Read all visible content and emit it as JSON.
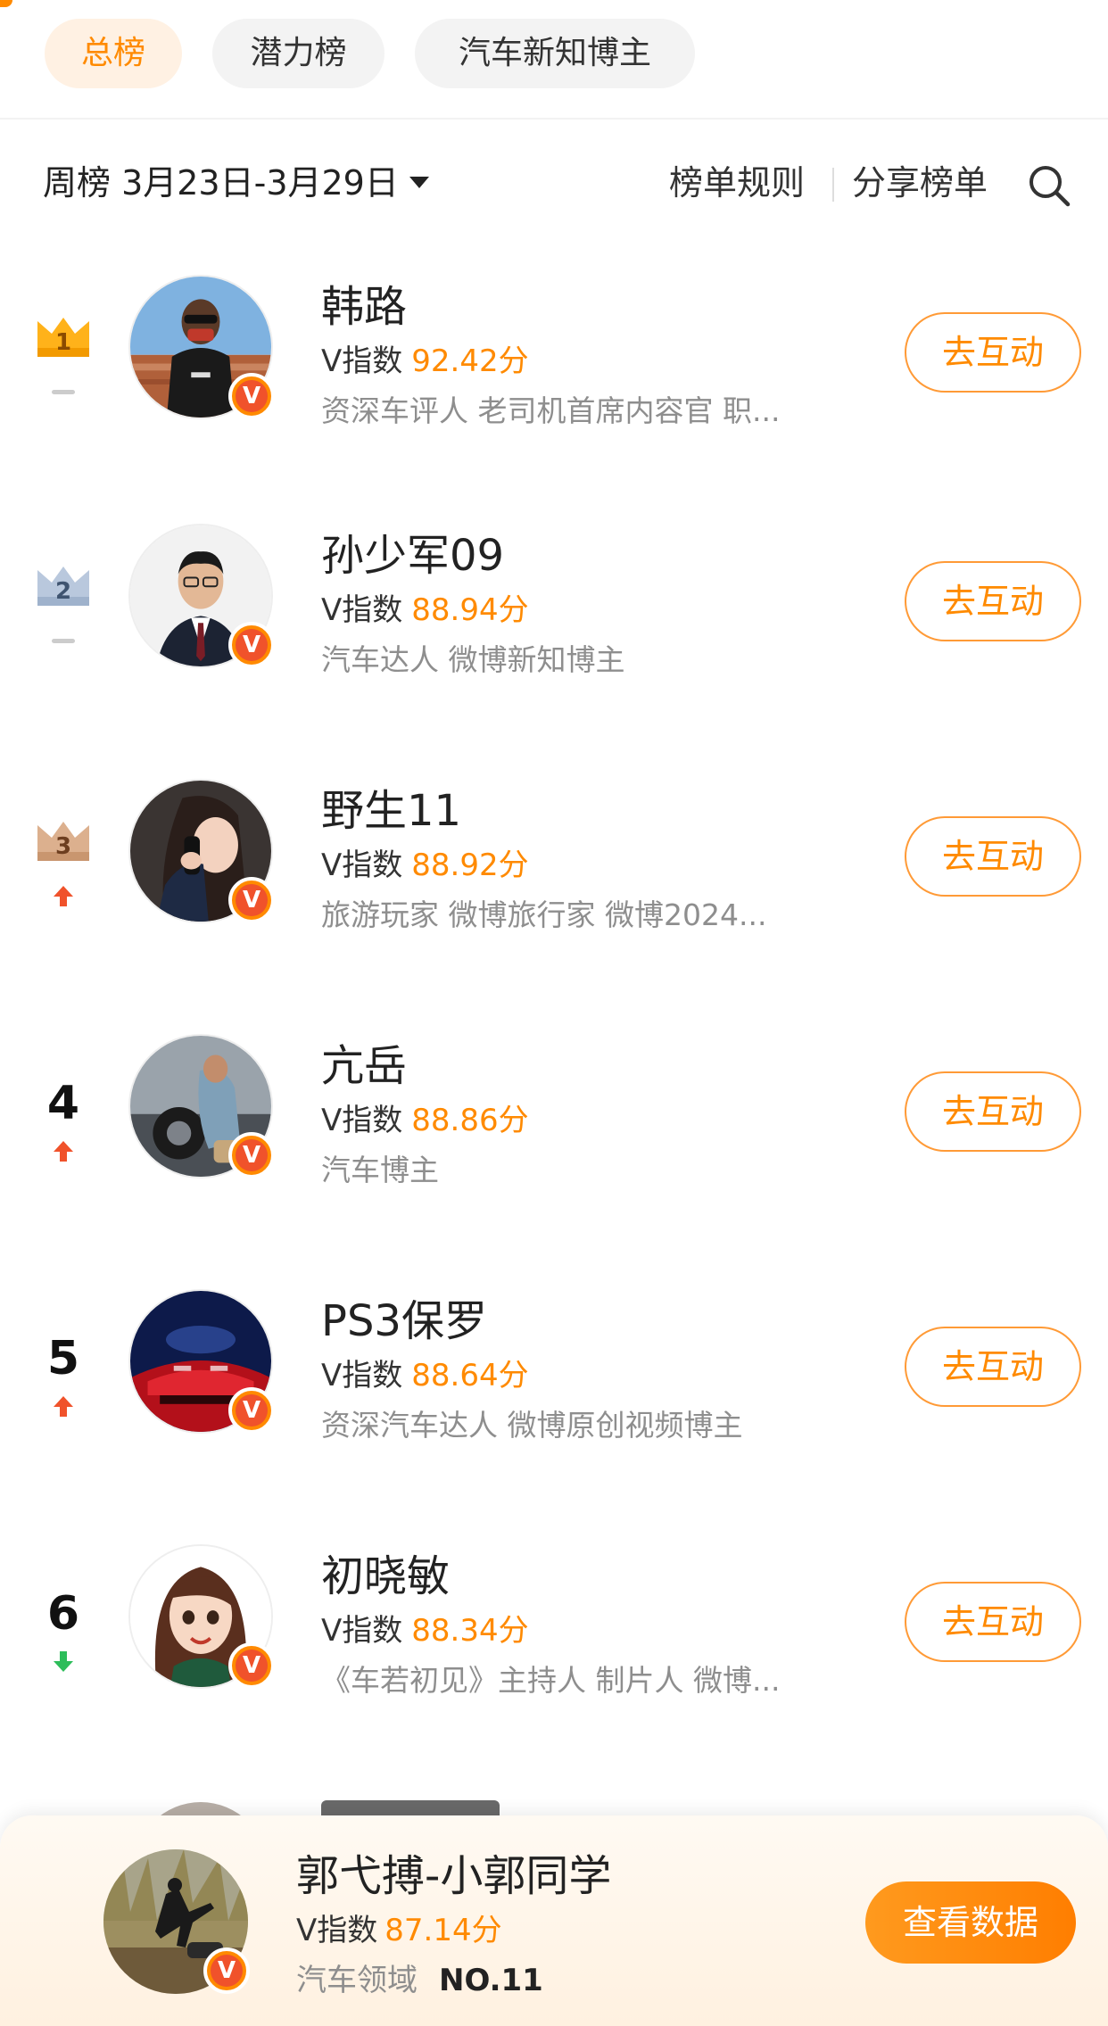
{
  "tabs": [
    {
      "label": "总榜",
      "active": true
    },
    {
      "label": "潜力榜",
      "active": false
    },
    {
      "label": "汽车新知博主",
      "active": false
    }
  ],
  "filter": {
    "period": "周榜 3月23日-3月29日",
    "rules": "榜单规则",
    "share": "分享榜单"
  },
  "score_prefix": "V指数",
  "interact_label": "去互动",
  "verified_mark": "V",
  "rows": [
    {
      "rank": "1",
      "badge": "gold",
      "trend": "same",
      "name": "韩路",
      "score": "92.42分",
      "desc": "资深车评人 老司机首席内容官 职..."
    },
    {
      "rank": "2",
      "badge": "silver",
      "trend": "same",
      "name": "孙少军09",
      "score": "88.94分",
      "desc": "汽车达人 微博新知博主"
    },
    {
      "rank": "3",
      "badge": "bronze",
      "trend": "up",
      "name": "野生11",
      "score": "88.92分",
      "desc": "旅游玩家 微博旅行家 微博2024..."
    },
    {
      "rank": "4",
      "badge": "",
      "trend": "up",
      "name": "亢岳",
      "score": "88.86分",
      "desc": "汽车博主"
    },
    {
      "rank": "5",
      "badge": "",
      "trend": "up",
      "name": "PS3保罗",
      "score": "88.64分",
      "desc": "资深汽车达人 微博原创视频博主"
    },
    {
      "rank": "6",
      "badge": "",
      "trend": "down",
      "name": "初晓敏",
      "score": "88.34分",
      "desc": "《车若初见》主持人 制片人 微博..."
    }
  ],
  "me": {
    "name": "郭弋搏-小郭同学",
    "score": "87.14分",
    "field": "汽车领域",
    "rank": "NO.11",
    "button": "查看数据"
  },
  "colors": {
    "accent": "#ff8a00",
    "up": "#f0522b",
    "down": "#2dbd5a",
    "same": "#cccccc"
  }
}
